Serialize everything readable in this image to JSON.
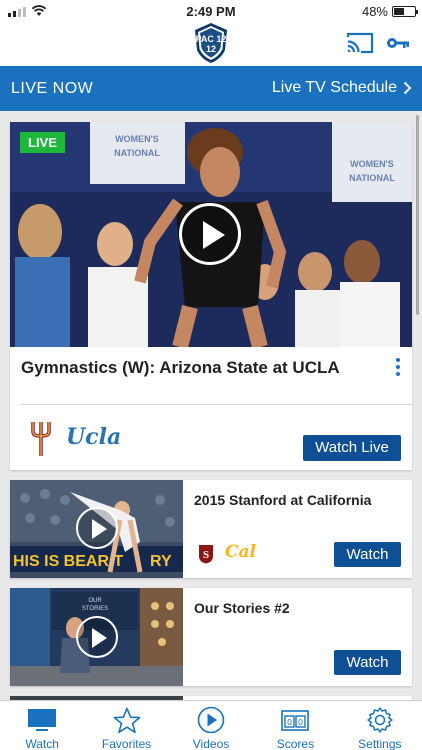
{
  "status_bar": {
    "time": "2:49 PM",
    "battery_percent": "48%",
    "battery_level": 0.48
  },
  "header": {
    "logo_text": "PAC 12"
  },
  "live_bar": {
    "title": "LIVE NOW",
    "schedule_label": "Live TV Schedule"
  },
  "hero": {
    "badge": "LIVE",
    "title": "Gymnastics (W): Arizona State at UCLA",
    "team_left": "Arizona State",
    "team_right_text": "Ucla",
    "button": "Watch Live",
    "banner_text_1": "WOMEN'S",
    "banner_text_2": "NATIONAL"
  },
  "videos": [
    {
      "title": "2015 Stanford at California",
      "button": "Watch",
      "thumb_banner": "HIS IS BEAR T",
      "thumb_banner_2": "RY",
      "team_right_text": "Cal"
    },
    {
      "title": "Our Stories #2",
      "button": "Watch",
      "thumb_label_1": "OUR",
      "thumb_label_2": "STORIES"
    }
  ],
  "tabs": [
    {
      "label": "Watch",
      "icon": "tv-icon",
      "active": true
    },
    {
      "label": "Favorites",
      "icon": "star-icon"
    },
    {
      "label": "Videos",
      "icon": "play-circle-icon"
    },
    {
      "label": "Scores",
      "icon": "scoreboard-icon"
    },
    {
      "label": "Settings",
      "icon": "gear-icon"
    }
  ],
  "colors": {
    "accent": "#1a72bf",
    "button": "#0e4f96",
    "live_badge": "#1db83a"
  }
}
